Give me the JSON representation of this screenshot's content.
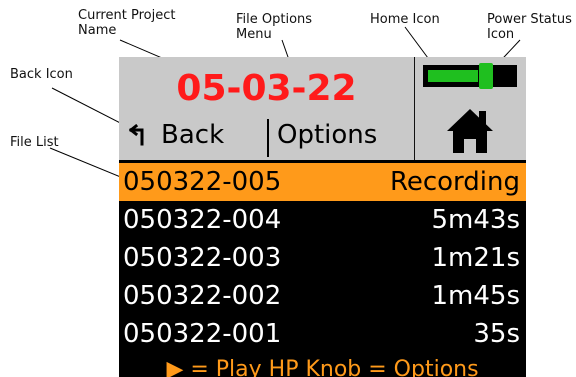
{
  "callouts": {
    "current_project_name": "Current Project\nName",
    "file_options_menu": "File Options\nMenu",
    "home_icon": "Home Icon",
    "power_status_icon": "Power Status\nIcon",
    "back_icon": "Back Icon",
    "file_list": "File List"
  },
  "header": {
    "project_name": "05-03-22",
    "back_label": "Back",
    "options_label": "Options"
  },
  "icons": {
    "back": "back-arrow-icon",
    "home": "home-icon",
    "power": "power-status-icon",
    "play": "play-icon"
  },
  "power_status": {
    "level": 0.6
  },
  "files": [
    {
      "name": "050322-005",
      "status": "Recording",
      "selected": true
    },
    {
      "name": "050322-004",
      "status": "5m43s",
      "selected": false
    },
    {
      "name": "050322-003",
      "status": "1m21s",
      "selected": false
    },
    {
      "name": "050322-002",
      "status": "1m45s",
      "selected": false
    },
    {
      "name": "050322-001",
      "status": "35s",
      "selected": false
    }
  ],
  "footer": {
    "play_glyph": "▶",
    "hint_text": " = Play   HP Knob = Options"
  },
  "colors": {
    "project_name": "#ff1a1a",
    "selected_row": "#ff9a1a",
    "footer_text": "#ff9a1a",
    "power_fill": "#1fbf1f",
    "header_bg": "#c9c9c9",
    "screen_bg": "#000000"
  }
}
